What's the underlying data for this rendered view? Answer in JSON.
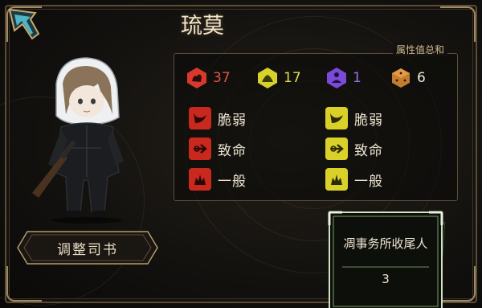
{
  "character": {
    "name": "琉莫"
  },
  "stats": {
    "title": "属性值总和",
    "items": [
      {
        "icon": "wrath-icon",
        "value": "37",
        "color": "#d9382c"
      },
      {
        "icon": "sloth-icon",
        "value": "17",
        "color": "#d6d22a"
      },
      {
        "icon": "gloom-icon",
        "value": "1",
        "color": "#7b4ad8"
      },
      {
        "icon": "dice-icon",
        "value": "6",
        "color": "#c47d2f"
      }
    ]
  },
  "resistances": {
    "red": [
      {
        "icon": "slash-icon",
        "label": "脆弱"
      },
      {
        "icon": "pierce-icon",
        "label": "致命"
      },
      {
        "icon": "blunt-icon",
        "label": "一般"
      }
    ],
    "yellow": [
      {
        "icon": "slash-icon",
        "label": "脆弱"
      },
      {
        "icon": "pierce-icon",
        "label": "致命"
      },
      {
        "icon": "blunt-icon",
        "label": "一般"
      }
    ],
    "colors": {
      "red": "#c8281e",
      "yellow": "#d9d12a"
    }
  },
  "actions": {
    "adjust_label": "调整司书"
  },
  "card": {
    "title": "凋事务所收尾人",
    "count": "3"
  }
}
